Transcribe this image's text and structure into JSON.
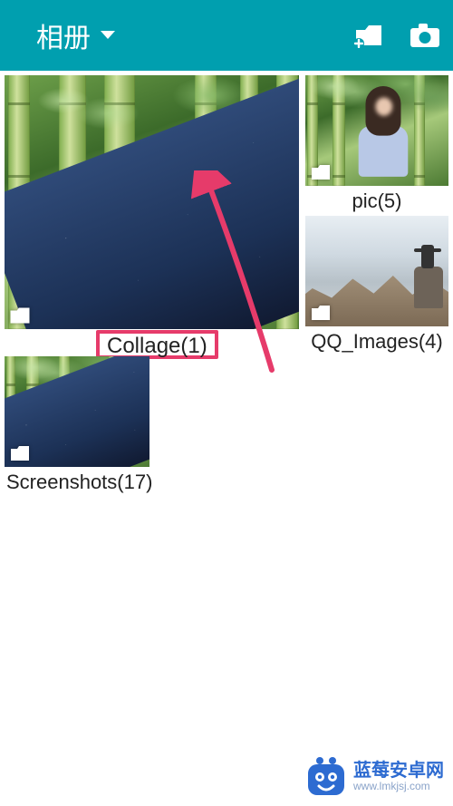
{
  "header": {
    "title": "相册",
    "actions": {
      "new_folder_icon": "new-folder-icon",
      "camera_icon": "camera-icon"
    }
  },
  "albums": {
    "collage": {
      "name": "Collage",
      "count": 1,
      "label": "Collage(1)"
    },
    "pic": {
      "name": "pic",
      "count": 5,
      "label": "pic(5)"
    },
    "qq_images": {
      "name": "QQ_Images",
      "count": 4,
      "label": "QQ_Images(4)"
    },
    "screenshots": {
      "name": "Screenshots",
      "count": 17,
      "label": "Screenshots(17)"
    }
  },
  "annotation": {
    "highlight_target": "Collage(1)"
  },
  "watermark": {
    "line1": "蓝莓安卓网",
    "line2": "www.lmkjsj.com"
  },
  "colors": {
    "header_bg": "#009faf",
    "highlight": "#e63b6a",
    "arrow": "#e63b6a"
  }
}
